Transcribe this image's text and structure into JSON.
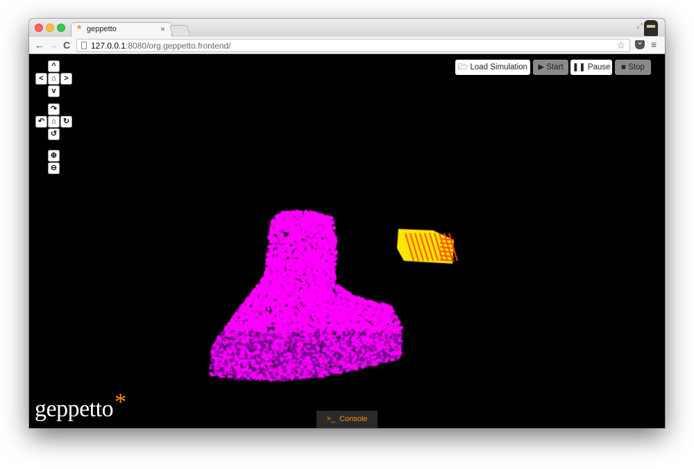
{
  "browser": {
    "tab_title": "geppetto",
    "tab_close": "×",
    "tab_favicon": "*",
    "url_host": "127.0.0.1",
    "url_rest": ":8080/org.geppetto.frontend/",
    "icons": {
      "back": "back-arrow-icon",
      "forward": "forward-arrow-icon",
      "reload": "reload-icon",
      "star": "bookmark-star-icon",
      "pocket": "pocket-icon",
      "menu": "hamburger-menu-icon"
    }
  },
  "controls": {
    "pan": {
      "up": "^",
      "down": "v",
      "left": "<",
      "right": ">",
      "home": "⌂"
    },
    "rotate": {
      "up": "↷",
      "down": "↺",
      "left": "↶",
      "right": "↻",
      "home": "⌂"
    },
    "zoom_in": "⊕",
    "zoom_out": "⊖"
  },
  "toolbar": {
    "load_label": "Load Simulation",
    "start_label": "Start",
    "pause_label": "Pause",
    "stop_label": "Stop"
  },
  "logo": {
    "text": "geppetto",
    "star": "*"
  },
  "console": {
    "label": "Console",
    "prompt": ">_"
  },
  "colors": {
    "accent": "#ff8c1a",
    "particle_main": "#ff00ff",
    "particle_secondary": "#ffe600",
    "particle_edge": "#ff4a00",
    "viewport_bg": "#000000"
  }
}
